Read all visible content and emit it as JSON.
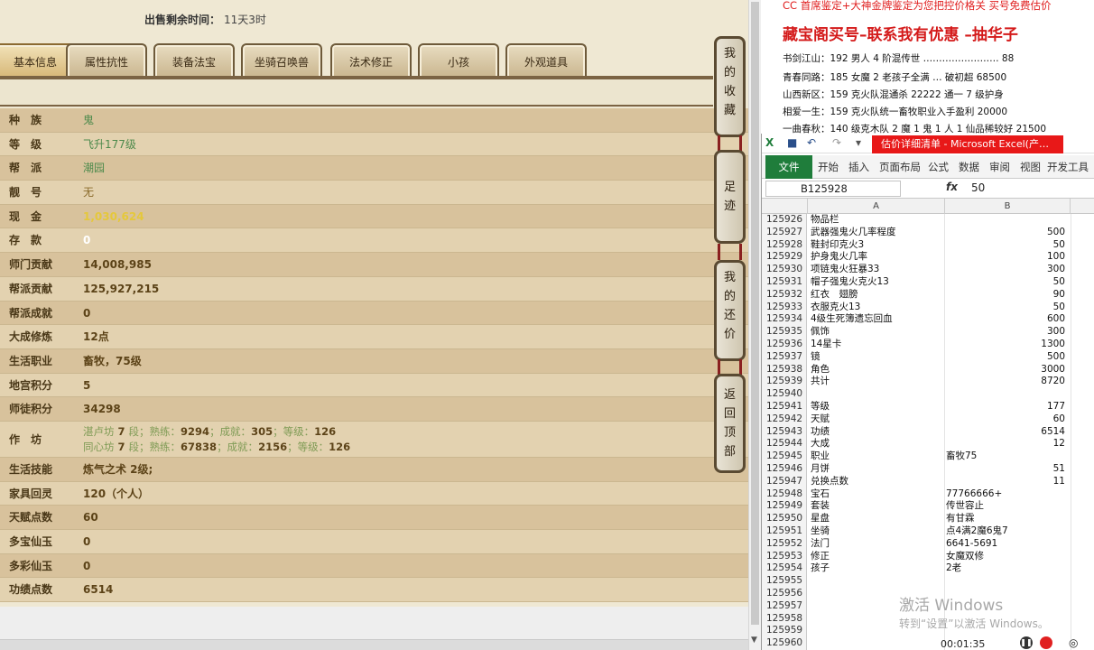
{
  "game": {
    "sale_time_label": "出售剩余时间：",
    "sale_time_value": "11天3时",
    "tabs": [
      "基本信息",
      "属性抗性",
      "装备法宝",
      "坐骑召唤兽",
      "法术修正",
      "小孩",
      "外观道具"
    ],
    "active_tab": "基本信息",
    "rows": [
      {
        "k": "种　族",
        "v": "鬼"
      },
      {
        "k": "等　级",
        "v": "飞升177级"
      },
      {
        "k": "帮　派",
        "v": "潮园"
      },
      {
        "k": "靓　号",
        "v": "无"
      },
      {
        "k": "现　金",
        "v": "1,030,624"
      },
      {
        "k": "存　款",
        "v": "0"
      },
      {
        "k": "师门贡献",
        "v": "14,008,985"
      },
      {
        "k": "帮派贡献",
        "v": "125,927,215"
      },
      {
        "k": "帮派成就",
        "v": "0"
      },
      {
        "k": "大成修炼",
        "v": "12点"
      },
      {
        "k": "生活职业",
        "v": "畜牧，75级"
      },
      {
        "k": "地宫积分",
        "v": "5"
      },
      {
        "k": "师徒积分",
        "v": "34298"
      }
    ],
    "workshop": {
      "k": "作　坊",
      "line1_name": "湛卢坊",
      "line1": {
        "seg": "7",
        "skill": "9294",
        "achieve": "305",
        "level": "126"
      },
      "line2_name": "同心坊",
      "line2": {
        "seg": "7",
        "skill": "67838",
        "achieve": "2156",
        "level": "126"
      },
      "seg_unit": "段；",
      "skill_label": "熟练：",
      "achieve_label": "；成就：",
      "level_label": "；等级："
    },
    "rows2": [
      {
        "k": "生活技能",
        "v": "炼气之术 2级;"
      },
      {
        "k": "家具回灵",
        "v": "120（个人）"
      },
      {
        "k": "天赋点数",
        "v": "60"
      },
      {
        "k": "多宝仙玉",
        "v": "0"
      },
      {
        "k": "多彩仙玉",
        "v": "0"
      },
      {
        "k": "功绩点数",
        "v": "6514"
      }
    ],
    "side_buttons": [
      {
        "label": "我的收藏",
        "chars": [
          "我",
          "的",
          "收",
          "藏"
        ]
      },
      {
        "label": "足迹",
        "chars": [
          "足",
          "迹"
        ]
      },
      {
        "label": "我的还价",
        "chars": [
          "我",
          "的",
          "还",
          "价"
        ]
      },
      {
        "label": "返回顶部",
        "chars": [
          "返",
          "回",
          "顶",
          "部"
        ]
      }
    ]
  },
  "notes": {
    "top": "CC 首席鉴定+大神金牌鉴定为您把控价格关 买号免费估价",
    "ad": "藏宝阁买号–联系我有优惠 –抽华子",
    "lines": [
      "书剑江山：192 男人 4 阶混传世 …………………… 88",
      "青春同路：185 女魔 2 老孩子全满 … 破初超 68500",
      "山西新区：159 克火队混通杀 22222 通一 7 级护身",
      "相爱一生：159 克火队统一畜牧职业入手盈利 20000",
      "一曲春秋：140 级克木队 2 魔 1 鬼 1 人 1 仙品稀较好 21500"
    ]
  },
  "excel": {
    "title": "估价详细清单 - Microsoft Excel(产…",
    "ribbon": [
      "文件",
      "开始",
      "插入",
      "页面布局",
      "公式",
      "数据",
      "审阅",
      "视图",
      "开发工具"
    ],
    "name_box": "B125928",
    "fx": "fx",
    "formula": "50",
    "col_a": "A",
    "col_b": "B",
    "rows": [
      {
        "n": "125926",
        "a": "物品栏",
        "b": ""
      },
      {
        "n": "125927",
        "a": "武器强鬼火几率程度",
        "b": "500"
      },
      {
        "n": "125928",
        "a": "鞋封印克火3",
        "b": "50"
      },
      {
        "n": "125929",
        "a": "护身鬼火几率",
        "b": "100"
      },
      {
        "n": "125930",
        "a": "项链鬼火狂暴33",
        "b": "300"
      },
      {
        "n": "125931",
        "a": "帽子强鬼火克火13",
        "b": "50"
      },
      {
        "n": "125932",
        "a": "红衣　翅膀",
        "b": "90"
      },
      {
        "n": "125933",
        "a": "衣服克火13",
        "b": "50"
      },
      {
        "n": "125934",
        "a": "4级生死簿遗忘回血",
        "b": "600"
      },
      {
        "n": "125935",
        "a": "佩饰",
        "b": "300"
      },
      {
        "n": "125936",
        "a": "14星卡",
        "b": "1300"
      },
      {
        "n": "125937",
        "a": "镜",
        "b": "500"
      },
      {
        "n": "125938",
        "a": "角色",
        "b": "3000"
      },
      {
        "n": "125939",
        "a": "共计",
        "b": "8720"
      },
      {
        "n": "125940",
        "a": "",
        "b": ""
      },
      {
        "n": "125941",
        "a": "等级",
        "b": "177"
      },
      {
        "n": "125942",
        "a": "天赋",
        "b": "60"
      },
      {
        "n": "125943",
        "a": "功绩",
        "b": "6514"
      },
      {
        "n": "125944",
        "a": "大成",
        "b": "12"
      },
      {
        "n": "125945",
        "a": "职业",
        "b": "畜牧75",
        "text": true
      },
      {
        "n": "125946",
        "a": "月饼",
        "b": "51"
      },
      {
        "n": "125947",
        "a": "兑换点数",
        "b": "11"
      },
      {
        "n": "125948",
        "a": "宝石",
        "b": "77766666+",
        "text": true
      },
      {
        "n": "125949",
        "a": "套装",
        "b": "传世容止",
        "text": true
      },
      {
        "n": "125950",
        "a": "星盘",
        "b": "有甘霖",
        "text": true
      },
      {
        "n": "125951",
        "a": "坐骑",
        "b": "点4满2魔6鬼7",
        "text": true
      },
      {
        "n": "125952",
        "a": "法门",
        "b": "6641-5691",
        "text": true
      },
      {
        "n": "125953",
        "a": "修正",
        "b": "女魔双修",
        "text": true
      },
      {
        "n": "125954",
        "a": "孩子",
        "b": "2老",
        "text": true
      },
      {
        "n": "125955",
        "a": "",
        "b": ""
      },
      {
        "n": "125956",
        "a": "",
        "b": ""
      },
      {
        "n": "125957",
        "a": "",
        "b": ""
      },
      {
        "n": "125958",
        "a": "",
        "b": ""
      },
      {
        "n": "125959",
        "a": "",
        "b": ""
      },
      {
        "n": "125960",
        "a": "",
        "b": ""
      }
    ],
    "watermark_title": "激活 Windows",
    "watermark_sub": "转到“设置”以激活 Windows。",
    "rec_time": "00:01:35"
  }
}
